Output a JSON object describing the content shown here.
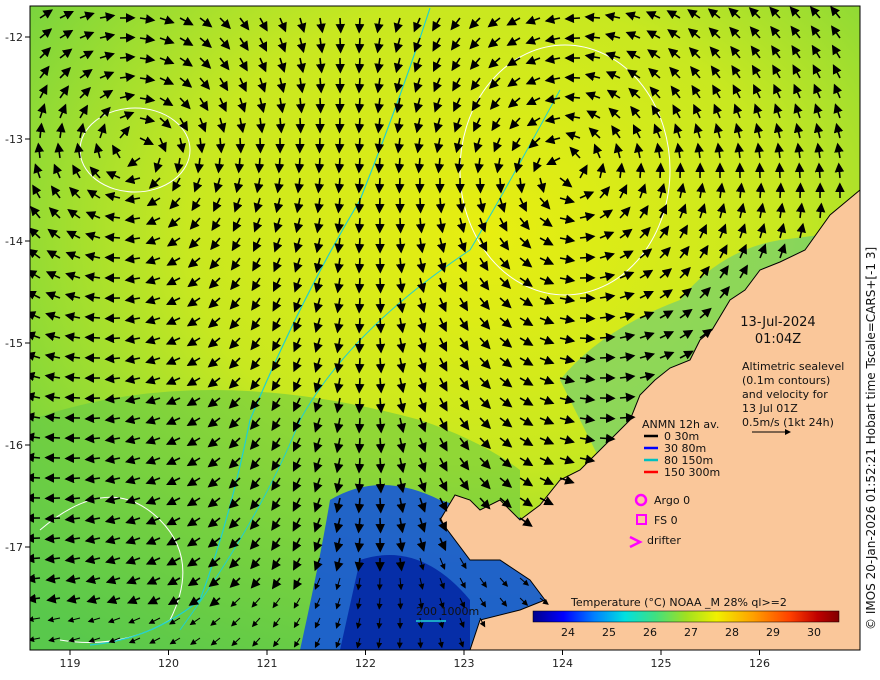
{
  "map": {
    "date": "13-Jul-2024",
    "time": "01:04Z",
    "side_text": "© IMOS 20-Jan-2026 01:52:21 Hobart time Tscale=CARS+[-1 3]",
    "info_lines": [
      "Altimetric sealevel",
      "(0.1m contours)",
      "and velocity for",
      "13 Jul 01Z",
      "0.5m/s (1kt 24h)"
    ],
    "x_ticks": [
      "119",
      "120",
      "121",
      "122",
      "123",
      "124",
      "125",
      "126"
    ],
    "y_ticks": [
      "-12",
      "-13",
      "-14",
      "-15",
      "-16",
      "-17"
    ],
    "bathy_label": "200  1000m",
    "colorbar": {
      "title": "Temperature (°C) NOAA _M 28% ql>=2",
      "ticks": [
        "24",
        "25",
        "26",
        "27",
        "28",
        "29",
        "30"
      ],
      "colors": [
        "#00008b",
        "#0000ff",
        "#0080ff",
        "#00e0e0",
        "#40e080",
        "#a0e020",
        "#f0f000",
        "#ffa000",
        "#ff4000",
        "#c00000",
        "#800000"
      ]
    },
    "mooring_legend": {
      "title": "ANMN 12h av.",
      "items": [
        {
          "label": "0 30m",
          "color": "#000000"
        },
        {
          "label": "30 80m",
          "color": "#0000ff"
        },
        {
          "label": "80 150m",
          "color": "#00c0c0"
        },
        {
          "label": "150 300m",
          "color": "#ff0000"
        }
      ]
    },
    "argo_label": "Argo 0",
    "fs_label": "FS 0",
    "drifter_label": "drifter",
    "colors": {
      "land": "#fac79a",
      "contour": "#ffffff",
      "bathy": "#20d0d0",
      "marker": "#ff00ff"
    }
  }
}
